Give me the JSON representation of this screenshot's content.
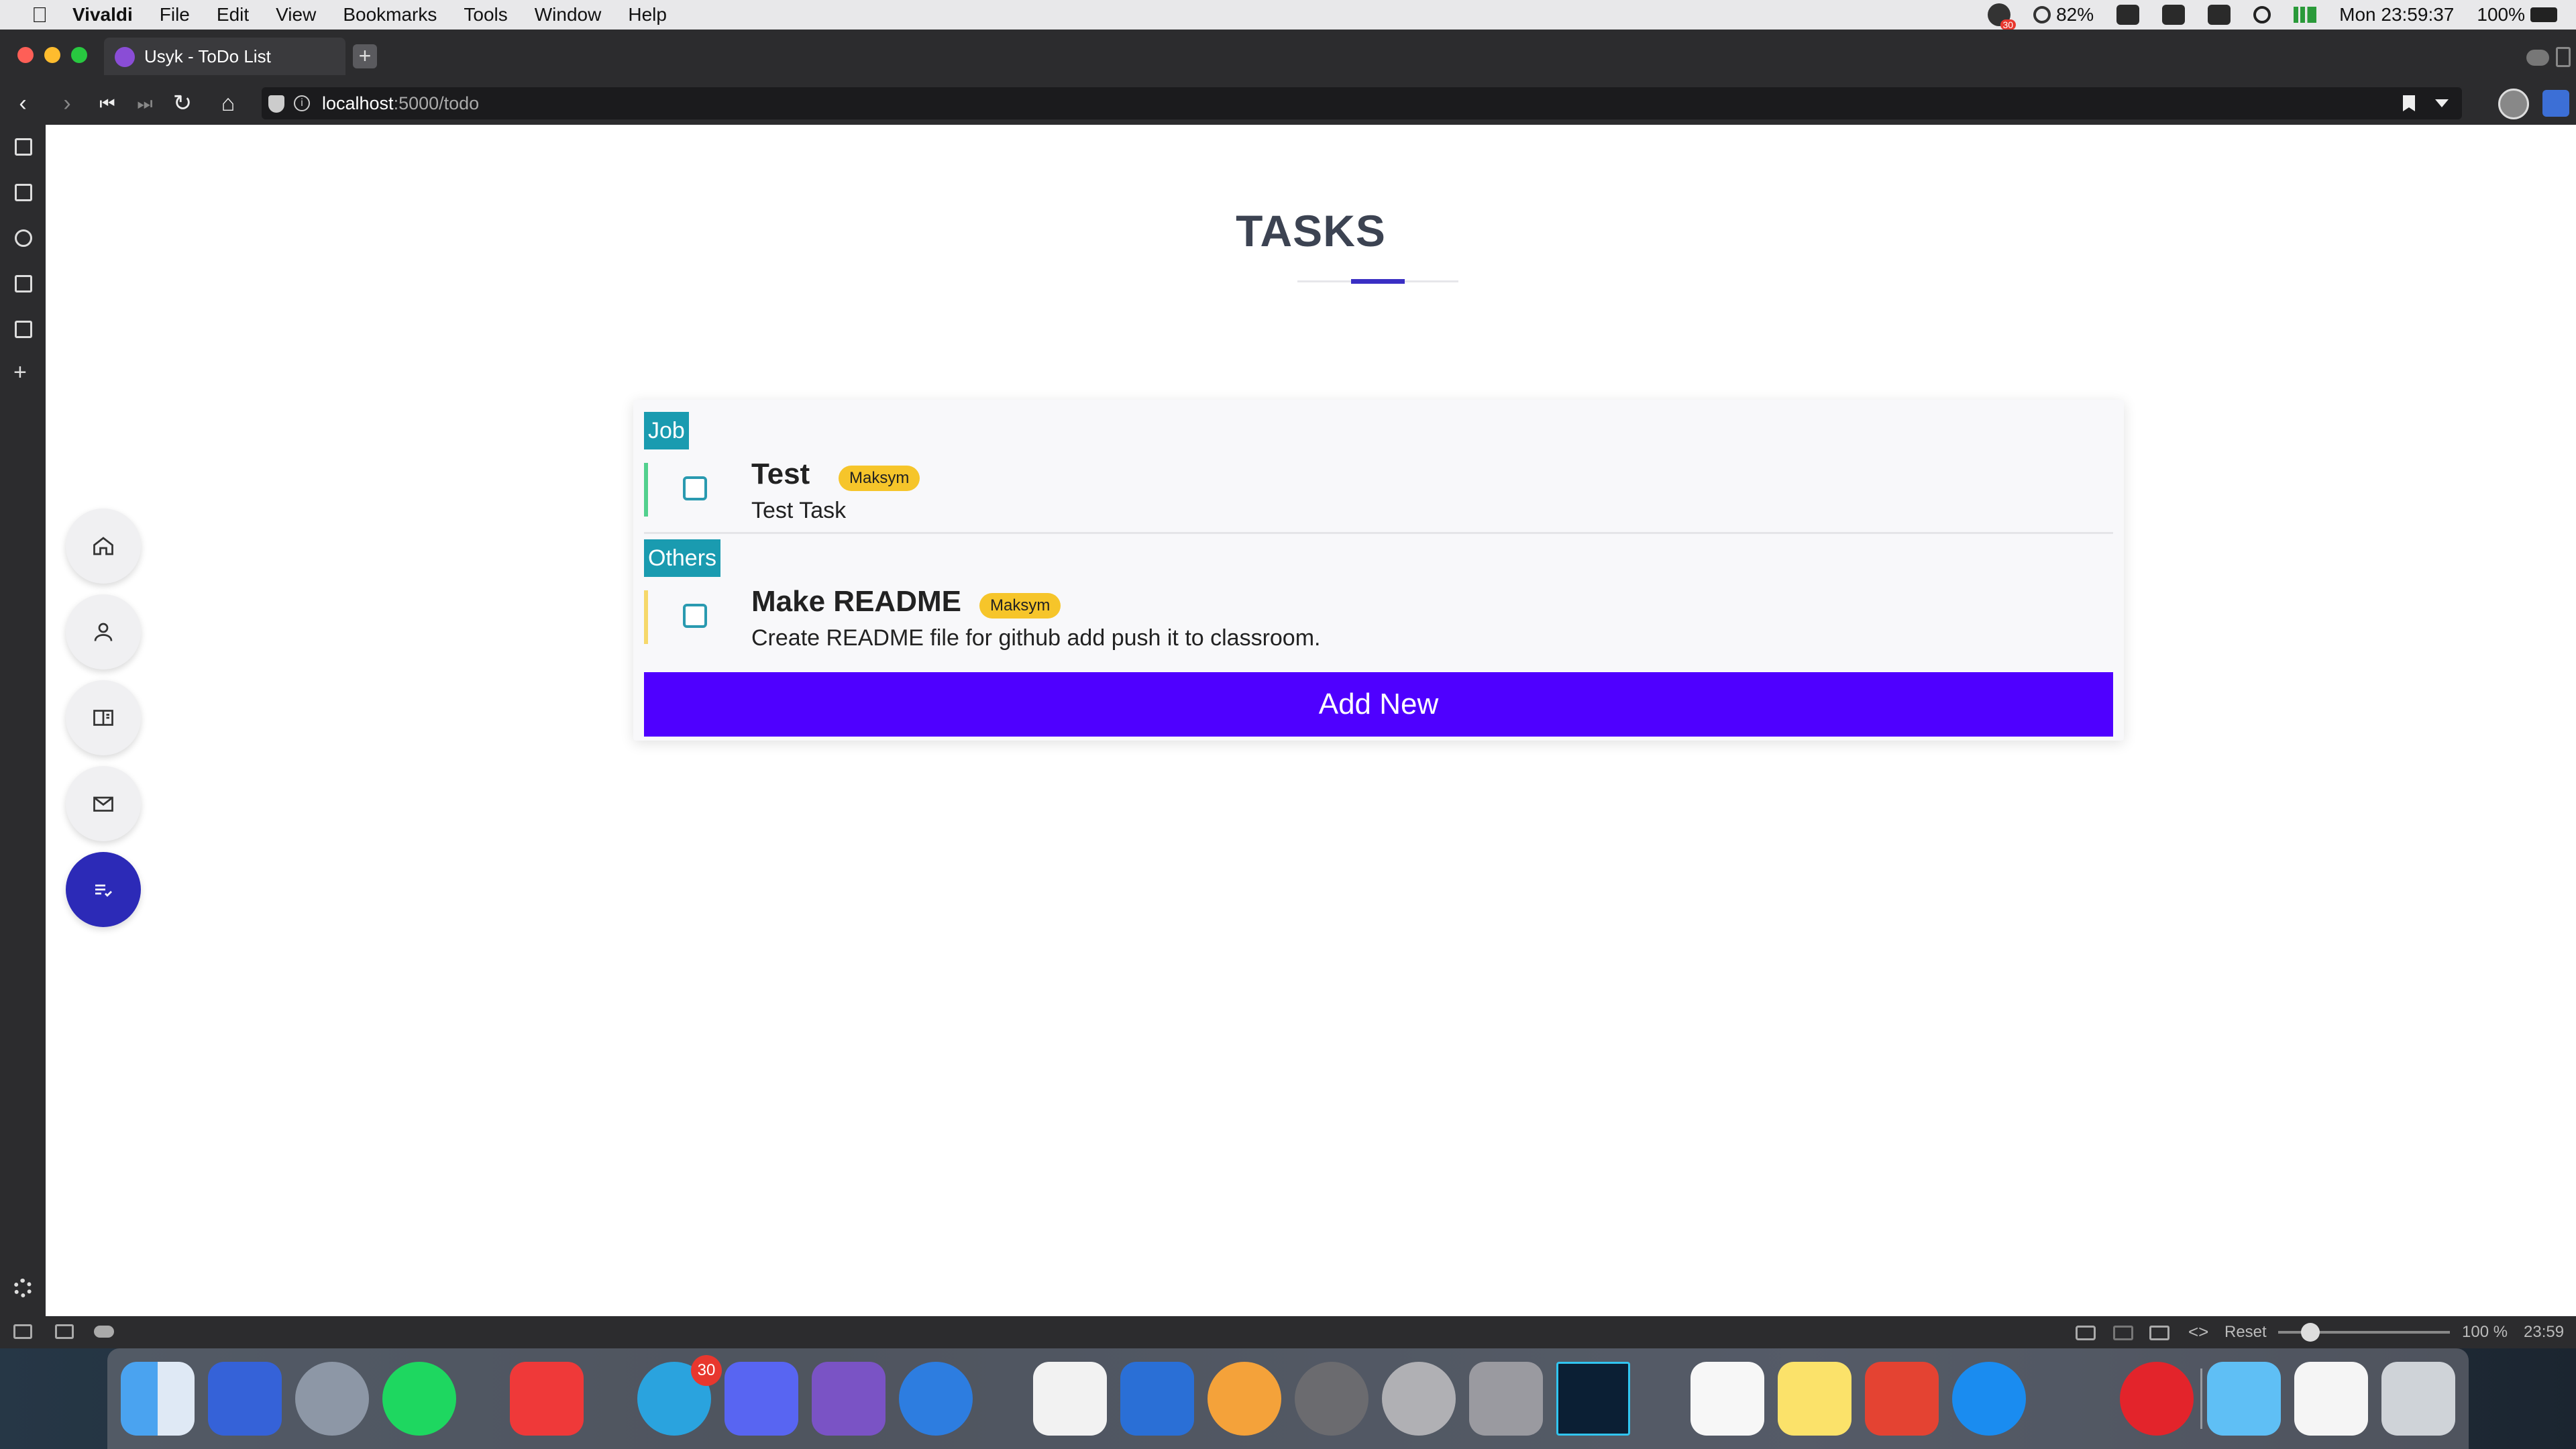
{
  "menubar": {
    "app_name": "Vivaldi",
    "items": [
      "File",
      "Edit",
      "View",
      "Bookmarks",
      "Tools",
      "Window",
      "Help"
    ],
    "status": {
      "notification_badge": "30",
      "cpu": "82%",
      "clock": "Mon 23:59:37",
      "battery": "100%"
    }
  },
  "browser": {
    "tab_title": "Usyk - ToDo List",
    "new_tab": "+",
    "url_host": "localhost",
    "url_path": ":5000/todo"
  },
  "page": {
    "title": "TASKS",
    "accent_color": "#3a2fc4",
    "categories": [
      {
        "label": "Job",
        "color": "#1a9bb0",
        "tasks": [
          {
            "title": "Test",
            "assignee": "Maksym",
            "description": "Test Task",
            "bar_color": "#52d08e"
          }
        ]
      },
      {
        "label": "Others",
        "color": "#1a9bb0",
        "tasks": [
          {
            "title": "Make README",
            "assignee": "Maksym",
            "description": "Create README file for github add push it to classroom.",
            "bar_color": "#f6d86a"
          }
        ]
      }
    ],
    "add_button": "Add New",
    "add_button_color": "#4f00ff"
  },
  "floating_nav": [
    {
      "icon": "home-icon"
    },
    {
      "icon": "user-icon"
    },
    {
      "icon": "book-icon"
    },
    {
      "icon": "mail-icon"
    },
    {
      "icon": "tasks-icon",
      "active": true
    }
  ],
  "statusbar": {
    "reset": "Reset",
    "zoom": "100 %",
    "clock": "23:59"
  },
  "dock": {
    "telegram_badge": "30",
    "apps": [
      "finder-icon",
      "calendar-icon",
      "launchpad-icon",
      "spotify-icon",
      "vivaldi-icon",
      "telegram-icon",
      "discord-icon",
      "viber-icon",
      "send-icon",
      "vscode-icon",
      "xcode-icon",
      "airship-icon",
      "tableplus-icon",
      "disk-icon",
      "database-icon",
      "photoshop-icon",
      "reminders-icon",
      "notes-icon",
      "todoist-icon",
      "appstore-icon",
      "adblock-icon",
      "folder-icon",
      "txt-file-icon",
      "trash-icon"
    ]
  }
}
